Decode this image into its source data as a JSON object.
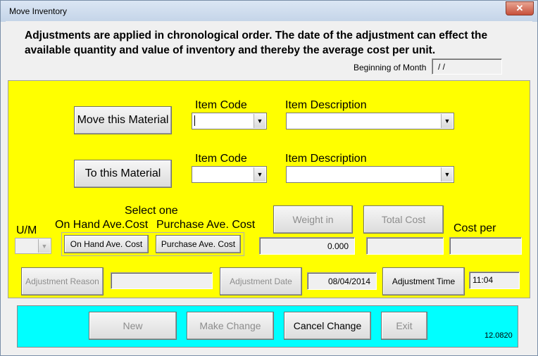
{
  "window": {
    "title": "Move Inventory",
    "close_glyph": "✕"
  },
  "notice": {
    "text": "Adjustments are applied in chronological order.  The date of the adjustment can effect the available quantity and value of inventory and thereby the average cost per unit."
  },
  "beginning_of_month": {
    "label": "Beginning of Month",
    "value": " / /"
  },
  "move_from": {
    "button": "Move this Material",
    "item_code_label": "Item Code",
    "item_desc_label": "Item Description",
    "item_code_value": "",
    "item_desc_value": ""
  },
  "move_to": {
    "button": "To this Material",
    "item_code_label": "Item Code",
    "item_desc_label": "Item Description",
    "item_code_value": "",
    "item_desc_value": ""
  },
  "cost_basis": {
    "select_label": "Select one",
    "on_hand_label": "On Hand Ave.Cost",
    "purchase_label": "Purchase Ave. Cost",
    "on_hand_button": "On Hand Ave. Cost",
    "purchase_button": "Purchase Ave. Cost"
  },
  "um": {
    "label": "U/M",
    "value": ""
  },
  "weight_in": {
    "button": "Weight in",
    "value": "0.000"
  },
  "total_cost": {
    "button": "Total Cost",
    "value": ""
  },
  "cost_per": {
    "label": "Cost per",
    "value": ""
  },
  "adjustment_reason": {
    "button": "Adjustment Reason",
    "value": ""
  },
  "adjustment_date": {
    "button": "Adjustment Date",
    "value": "08/04/2014"
  },
  "adjustment_time": {
    "button": "Adjustment Time",
    "value": "11:04"
  },
  "footer": {
    "new": "New",
    "make_change": "Make Change",
    "cancel_change": "Cancel Change",
    "exit": "Exit",
    "version": "12.0820"
  },
  "colors": {
    "panel": "#ffff00",
    "footer_panel": "#00ffff"
  },
  "icons": {
    "dropdown": "chevron-down-icon",
    "close": "close-icon"
  }
}
